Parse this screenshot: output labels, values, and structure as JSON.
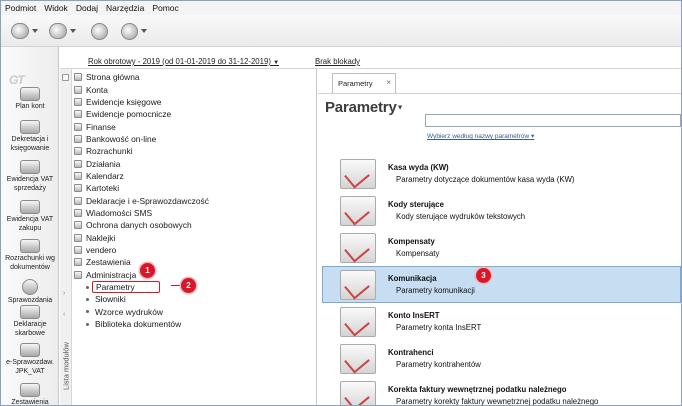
{
  "menu": [
    "Podmiot",
    "Widok",
    "Dodaj",
    "Narzędzia",
    "Pomoc"
  ],
  "modules": [
    {
      "label": "Plan kont",
      "icon": "book-icon"
    },
    {
      "label": "Dekretacja i księgowanie",
      "icon": "pen-icon"
    },
    {
      "label": "Ewidencja VAT sprzedaży",
      "icon": "register-icon"
    },
    {
      "label": "Ewidencja VAT zakupu",
      "icon": "register-icon"
    },
    {
      "label": "Rozrachunki wg dokumentów",
      "icon": "coins-icon"
    },
    {
      "label": "Sprawozdania",
      "icon": "chart-icon"
    },
    {
      "label": "Deklaracje skarbowe",
      "icon": "form-icon"
    },
    {
      "label": "e-Sprawozdaw. JPK_VAT",
      "icon": "jpk-icon"
    },
    {
      "label": "Zestawienia",
      "icon": "list-icon"
    }
  ],
  "status": {
    "fiscal_year": "Rok obrotowy - 2019  (od 01-01-2019 do 31-12-2019)",
    "lock": "Brak blokady"
  },
  "side_label": "Lista modułów",
  "tree": [
    {
      "label": "Strona główna"
    },
    {
      "label": "Konta"
    },
    {
      "label": "Ewidencje księgowe"
    },
    {
      "label": "Ewidencje pomocnicze"
    },
    {
      "label": "Finanse"
    },
    {
      "label": "Bankowość on-line"
    },
    {
      "label": "Rozrachunki"
    },
    {
      "label": "Działania"
    },
    {
      "label": "Kalendarz"
    },
    {
      "label": "Kartoteki"
    },
    {
      "label": "Deklaracje i e-Sprawozdawczość"
    },
    {
      "label": "Wiadomości SMS"
    },
    {
      "label": "Ochrona danych osobowych"
    },
    {
      "label": "Naklejki"
    },
    {
      "label": "vendero"
    },
    {
      "label": "Zestawienia"
    },
    {
      "label": "Administracja"
    }
  ],
  "tree_children": [
    {
      "label": "Parametry"
    },
    {
      "label": "Słowniki"
    },
    {
      "label": "Wzorce wydruków"
    },
    {
      "label": "Biblioteka dokumentów"
    }
  ],
  "tab": {
    "label": "Parametry",
    "close": "×"
  },
  "page": {
    "title": "Parametry",
    "search_hint": "Wybierz według nazwy parametrów"
  },
  "params": [
    {
      "name": "Kasa wyda (KW)",
      "desc": "Parametry dotyczące dokumentów kasa wyda (KW)"
    },
    {
      "name": "Kody sterujące",
      "desc": "Kody sterujące wydruków tekstowych"
    },
    {
      "name": "Kompensaty",
      "desc": "Kompensaty"
    },
    {
      "name": "Komunikacja",
      "desc": "Parametry komunikacji"
    },
    {
      "name": "Konto InsERT",
      "desc": "Parametry konta InsERT"
    },
    {
      "name": "Kontrahenci",
      "desc": "Parametry kontrahentów"
    },
    {
      "name": "Korekta faktury wewnętrznej podatku należnego",
      "desc": "Parametry korekty faktury wewnętrznej podatku należnego"
    }
  ],
  "badges": [
    "1",
    "2",
    "3"
  ],
  "colors": {
    "highlight": "#c7ddf1",
    "badge": "#d7182a"
  }
}
